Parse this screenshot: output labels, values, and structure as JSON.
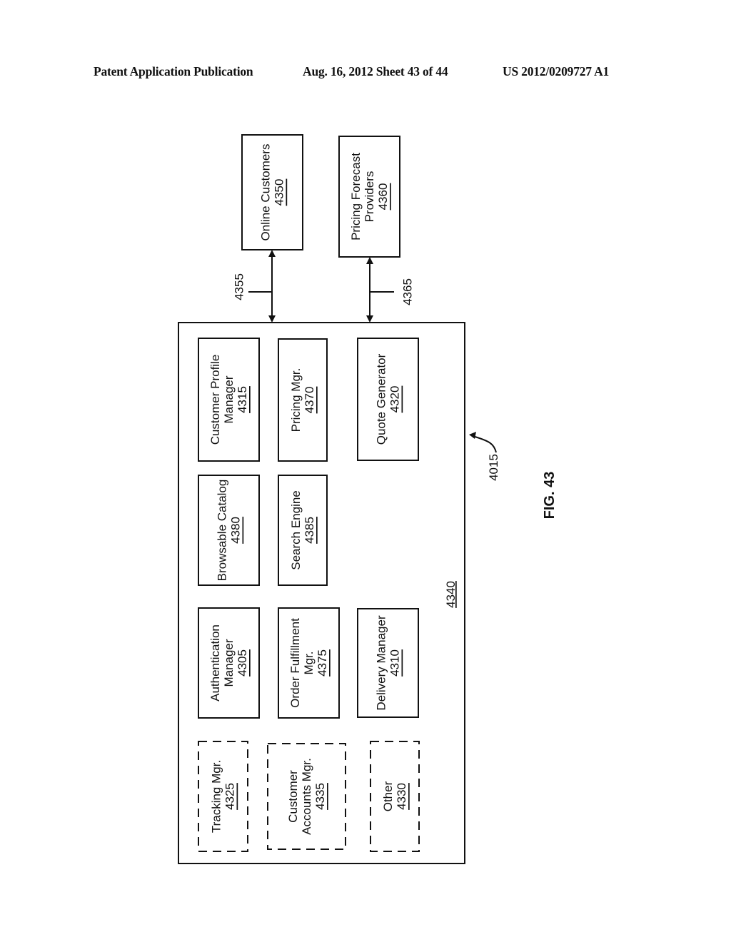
{
  "header": {
    "publication": "Patent Application Publication",
    "date_sheet": "Aug. 16, 2012  Sheet 43 of 44",
    "patent_number": "US 2012/0209727 A1"
  },
  "figure": {
    "label": "FIG. 43",
    "system_ref": "4015",
    "container_ref": "4340"
  },
  "external": [
    {
      "id": "online-customers",
      "lines": [
        "Online Customers"
      ],
      "ref": "4350",
      "link_ref": "4355"
    },
    {
      "id": "pricing-forecast-providers",
      "lines": [
        "Pricing Forecast",
        "Providers"
      ],
      "ref": "4360",
      "link_ref": "4365"
    }
  ],
  "modules": [
    {
      "id": "customer-profile-manager",
      "lines": [
        "Customer Profile",
        "Manager"
      ],
      "ref": "4315",
      "dashed": false
    },
    {
      "id": "pricing-mgr",
      "lines": [
        "Pricing Mgr."
      ],
      "ref": "4370",
      "dashed": false
    },
    {
      "id": "quote-generator",
      "lines": [
        "Quote Generator"
      ],
      "ref": "4320",
      "dashed": false
    },
    {
      "id": "browsable-catalog",
      "lines": [
        "Browsable Catalog"
      ],
      "ref": "4380",
      "dashed": false
    },
    {
      "id": "search-engine",
      "lines": [
        "Search Engine"
      ],
      "ref": "4385",
      "dashed": false
    },
    {
      "id": "authentication-manager",
      "lines": [
        "Authentication",
        "Manager"
      ],
      "ref": "4305",
      "dashed": false
    },
    {
      "id": "order-fulfillment-mgr",
      "lines": [
        "Order Fulfillment",
        "Mgr."
      ],
      "ref": "4375",
      "dashed": false
    },
    {
      "id": "delivery-manager",
      "lines": [
        "Delivery Manager"
      ],
      "ref": "4310",
      "dashed": false
    },
    {
      "id": "tracking-mgr",
      "lines": [
        "Tracking Mgr."
      ],
      "ref": "4325",
      "dashed": true
    },
    {
      "id": "customer-accounts-mgr",
      "lines": [
        "Customer",
        "Accounts Mgr."
      ],
      "ref": "4335",
      "dashed": true
    },
    {
      "id": "other",
      "lines": [
        "Other"
      ],
      "ref": "4330",
      "dashed": true
    }
  ]
}
